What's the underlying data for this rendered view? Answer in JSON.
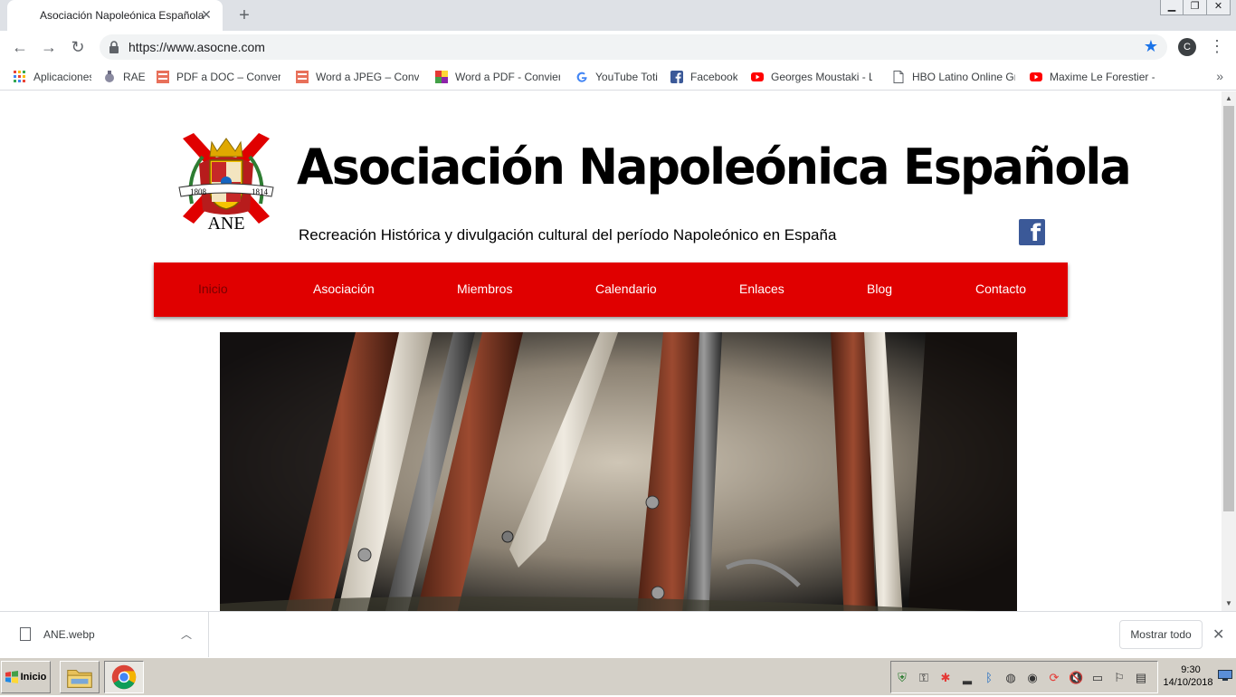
{
  "browser": {
    "tab": {
      "title": "Asociación Napoleónica Española",
      "close": "✕"
    },
    "new_tab": "+",
    "window_controls": {
      "minimize": "▁",
      "restore": "❐",
      "close": "✕"
    },
    "toolbar": {
      "back": "←",
      "forward": "→",
      "reload": "↻",
      "url": "https://www.asocne.com",
      "bookmark_star": "★",
      "profile_initial": "C",
      "menu": "⋮"
    },
    "bookmarks": [
      {
        "label": "Aplicaciones",
        "icon": "apps-grid-icon"
      },
      {
        "label": "RAE",
        "icon": "rae-icon"
      },
      {
        "label": "PDF a DOC – Convertir",
        "icon": "pdf-doc-icon"
      },
      {
        "label": "Word a JPEG – Conviert",
        "icon": "doc-jpg-icon"
      },
      {
        "label": "Word a PDF - Convierte",
        "icon": "colorful-squares-icon"
      },
      {
        "label": "YouTube Toti",
        "icon": "google-icon"
      },
      {
        "label": "Facebook",
        "icon": "facebook-icon"
      },
      {
        "label": "Georges Moustaki - Le",
        "icon": "youtube-icon"
      },
      {
        "label": "HBO Latino Online Grat",
        "icon": "page-icon"
      },
      {
        "label": "Maxime Le Forestier - ",
        "icon": "youtube-icon"
      }
    ],
    "bookmarks_overflow": "»"
  },
  "site": {
    "title": "Asociación Napoleónica Española",
    "subtitle": "Recreación Histórica y divulgación cultural del período Napoleónico en España",
    "logo": {
      "years_left": "1808",
      "years_right": "1814",
      "acronym": "ANE"
    },
    "facebook_glyph": "f",
    "nav": [
      {
        "label": "Inicio",
        "active": true
      },
      {
        "label": "Asociación",
        "active": false
      },
      {
        "label": "Miembros",
        "active": false
      },
      {
        "label": "Calendario",
        "active": false
      },
      {
        "label": "Enlaces",
        "active": false
      },
      {
        "label": "Blog",
        "active": false
      },
      {
        "label": "Contacto",
        "active": false
      }
    ]
  },
  "downloads": {
    "file_name": "ANE.webp",
    "chevron": "︿",
    "show_all": "Mostrar todo",
    "close": "✕"
  },
  "taskbar": {
    "start_label": "Inicio",
    "clock_time": "9:30",
    "clock_date": "14/10/2018"
  },
  "colors": {
    "nav_red": "#e00000",
    "nav_active_text": "#7a0000",
    "facebook_blue": "#3b5998",
    "star_blue": "#1a73e8"
  }
}
